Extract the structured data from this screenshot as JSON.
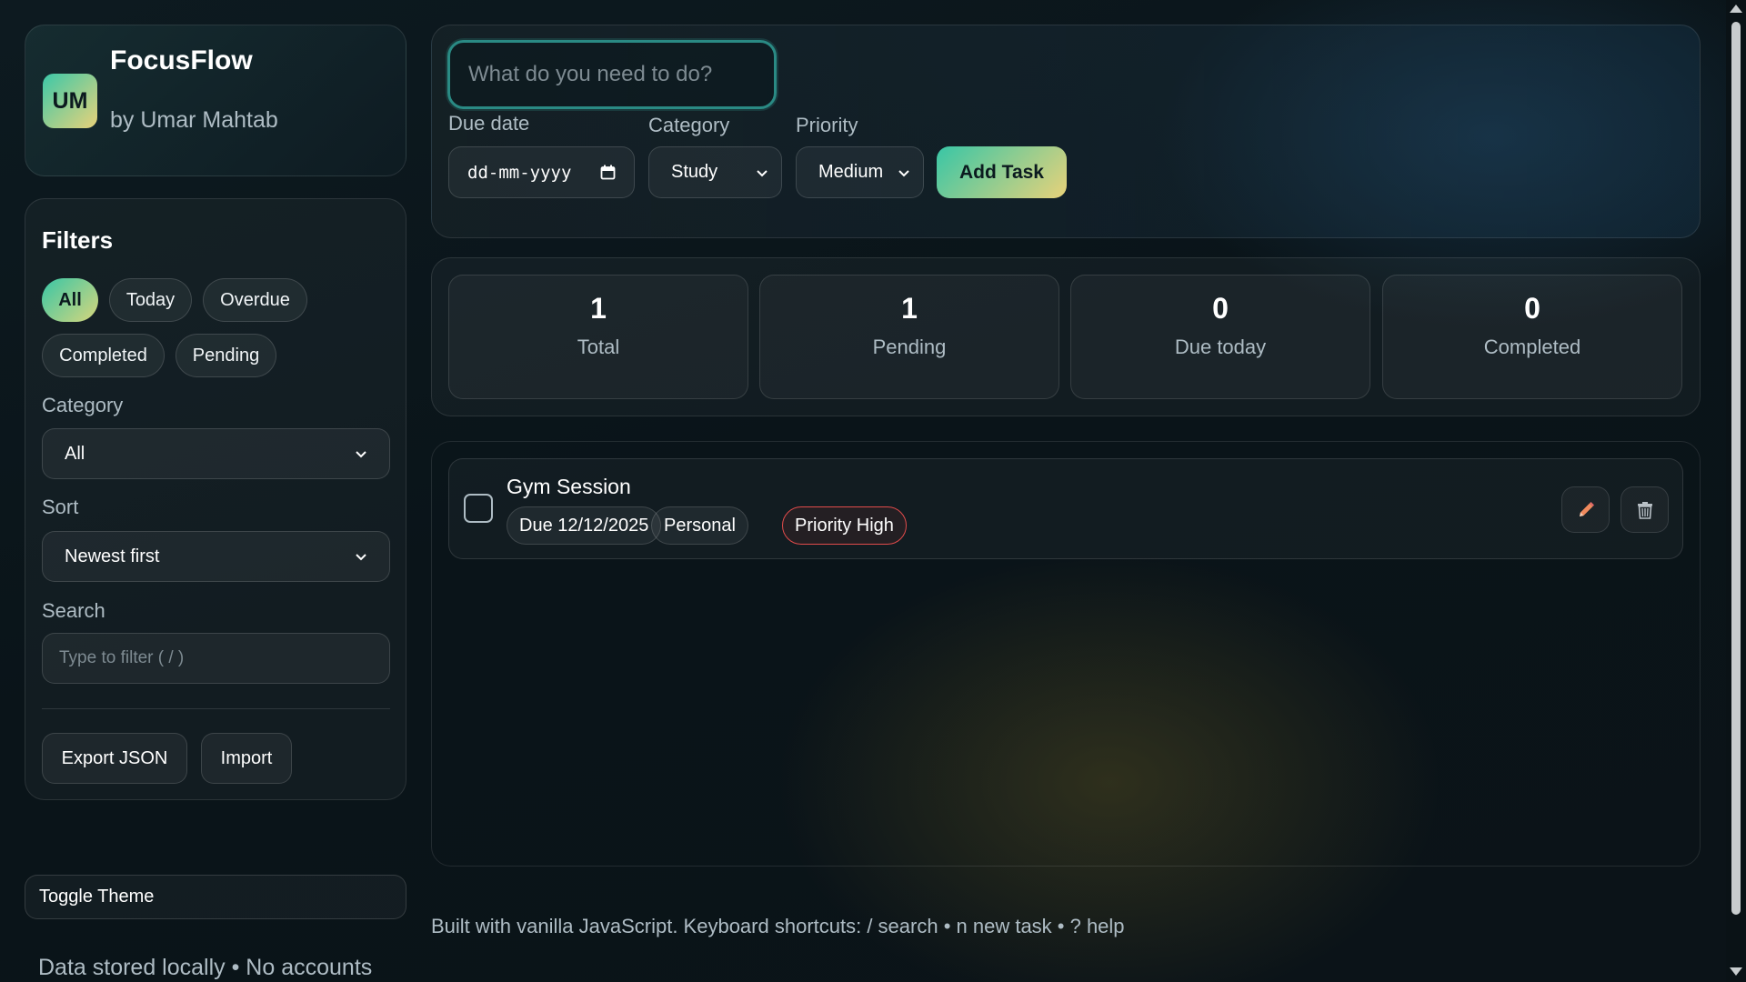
{
  "brand": {
    "avatar": "UM",
    "title": "FocusFlow",
    "subtitle": "by Umar Mahtab"
  },
  "filters": {
    "title": "Filters",
    "chips": [
      "All",
      "Today",
      "Overdue",
      "Completed",
      "Pending"
    ],
    "active_chip": "All",
    "category_label": "Category",
    "category_value": "All",
    "sort_label": "Sort",
    "sort_value": "Newest first",
    "search_label": "Search",
    "search_placeholder": "Type to filter ( / )",
    "export_label": "Export JSON",
    "import_label": "Import"
  },
  "sidebar_footer": {
    "toggle_theme": "Toggle Theme",
    "note": "Data stored locally • No accounts"
  },
  "add_task": {
    "input_placeholder": "What do you need to do?",
    "due_label": "Due date",
    "due_placeholder": "dd-mm-yyyy",
    "category_label": "Category",
    "category_value": "Study",
    "priority_label": "Priority",
    "priority_value": "Medium",
    "add_button": "Add Task"
  },
  "stats": [
    {
      "value": "1",
      "label": "Total"
    },
    {
      "value": "1",
      "label": "Pending"
    },
    {
      "value": "0",
      "label": "Due today"
    },
    {
      "value": "0",
      "label": "Completed"
    }
  ],
  "tasks": [
    {
      "title": "Gym Session",
      "due": "Due 12/12/2025",
      "category": "Personal",
      "priority": "Priority High",
      "completed": false
    }
  ],
  "footer": {
    "note": "Built with vanilla JavaScript. Keyboard shortcuts: / search • n new task • ? help"
  },
  "colors": {
    "accent_start": "#38c6a6",
    "accent_end": "#e8d27a",
    "priority_high": "#e04b4b",
    "edit_icon": "#f08a5d"
  },
  "icons": [
    "calendar-icon",
    "chevron-down-icon",
    "pencil-icon",
    "trash-icon"
  ]
}
